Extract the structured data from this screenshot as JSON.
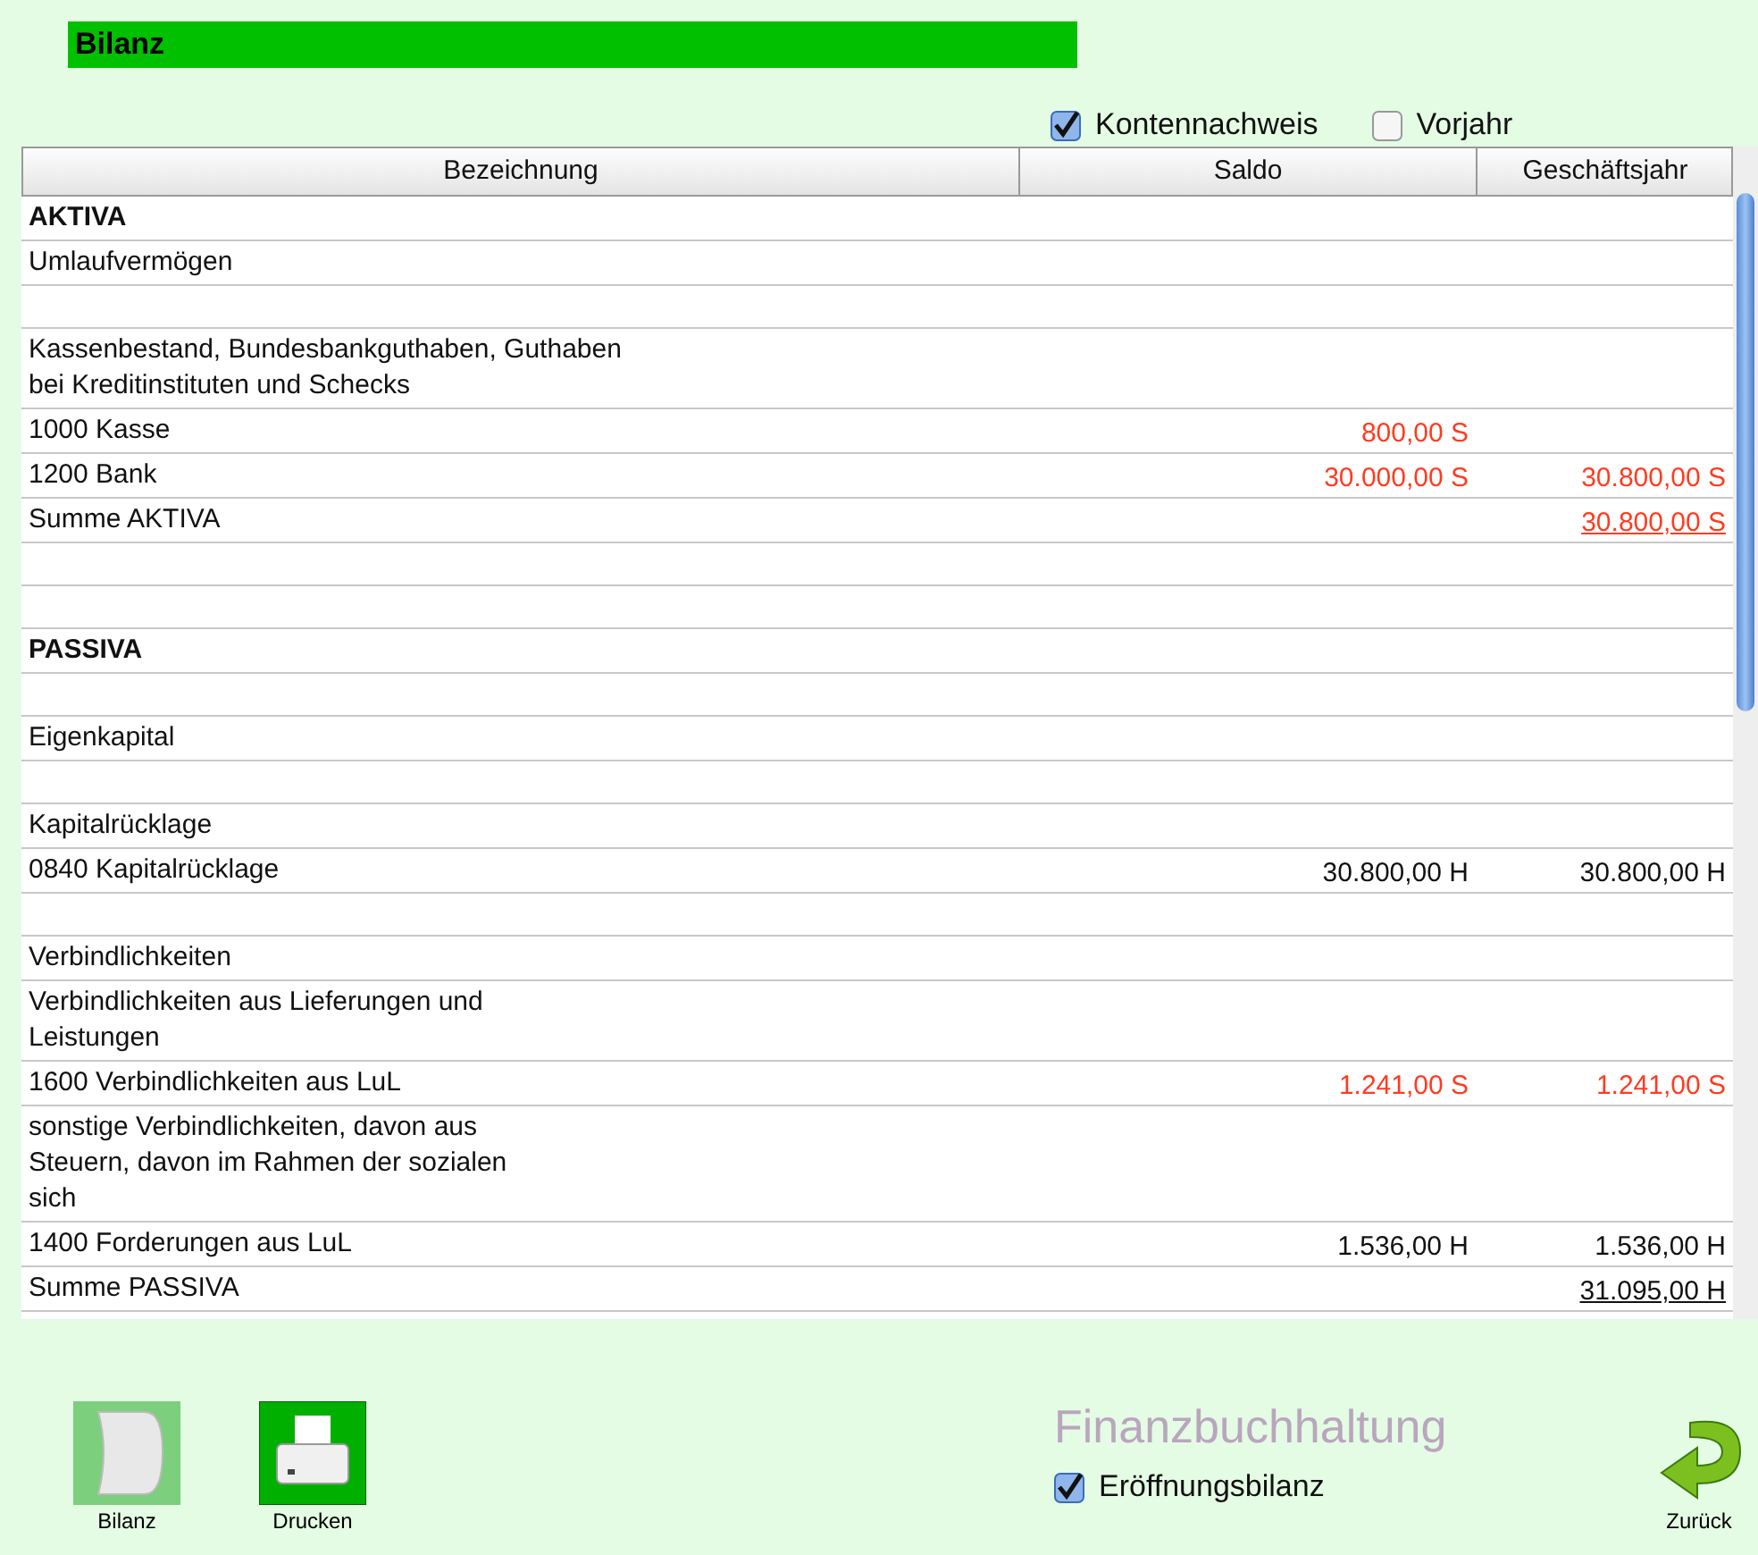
{
  "title": "Bilanz",
  "options": [
    {
      "label": "Kontennachweis",
      "checked": true
    },
    {
      "label": "Vorjahr",
      "checked": false
    }
  ],
  "table": {
    "columns": [
      "Bezeichnung",
      "Saldo",
      "Geschäftsjahr"
    ],
    "rows": [
      {
        "kind": "heading",
        "label": "AKTIVA"
      },
      {
        "kind": "line",
        "label": "Umlaufvermögen"
      },
      {
        "kind": "blank"
      },
      {
        "kind": "line",
        "label": "Kassenbestand, Bundesbankguthaben, Guthaben\nbei Kreditinstituten und Schecks"
      },
      {
        "kind": "line",
        "label": "1000 Kasse",
        "saldo": "800,00 S",
        "highlighted": true
      },
      {
        "kind": "line",
        "label": "1200 Bank",
        "saldo": "30.000,00 S",
        "year": "30.800,00 S",
        "highlighted": true
      },
      {
        "kind": "total",
        "label": "Summe AKTIVA",
        "year": "30.800,00 S",
        "highlighted": true
      },
      {
        "kind": "blank"
      },
      {
        "kind": "blank"
      },
      {
        "kind": "heading",
        "label": "PASSIVA"
      },
      {
        "kind": "blank"
      },
      {
        "kind": "line",
        "label": "Eigenkapital"
      },
      {
        "kind": "blank"
      },
      {
        "kind": "line",
        "label": "Kapitalrücklage"
      },
      {
        "kind": "line",
        "label": "0840 Kapitalrücklage",
        "saldo": "30.800,00 H",
        "year": "30.800,00 H",
        "highlighted": false
      },
      {
        "kind": "blank"
      },
      {
        "kind": "line",
        "label": "Verbindlichkeiten"
      },
      {
        "kind": "line",
        "label": "Verbindlichkeiten aus Lieferungen und\nLeistungen"
      },
      {
        "kind": "line",
        "label": "1600 Verbindlichkeiten aus LuL",
        "saldo": "1.241,00 S",
        "year": "1.241,00 S",
        "highlighted": true
      },
      {
        "kind": "line",
        "label": "sonstige Verbindlichkeiten, davon aus\nSteuern, davon im Rahmen der sozialen\nsich"
      },
      {
        "kind": "line",
        "label": "1400 Forderungen aus LuL",
        "saldo": "1.536,00 H",
        "year": "1.536,00 H",
        "highlighted": false
      },
      {
        "kind": "total",
        "label": "Summe PASSIVA",
        "year": "31.095,00 H",
        "highlighted": false
      }
    ]
  },
  "footer": {
    "buttons": [
      {
        "kind": "report",
        "label": "Bilanz"
      },
      {
        "kind": "print",
        "label": "Drucken"
      }
    ],
    "watermark": "Finanzbuchhaltung",
    "option": {
      "label": "Eröffnungsbilanz",
      "checked": true
    },
    "back": {
      "label": "Zurück"
    }
  }
}
